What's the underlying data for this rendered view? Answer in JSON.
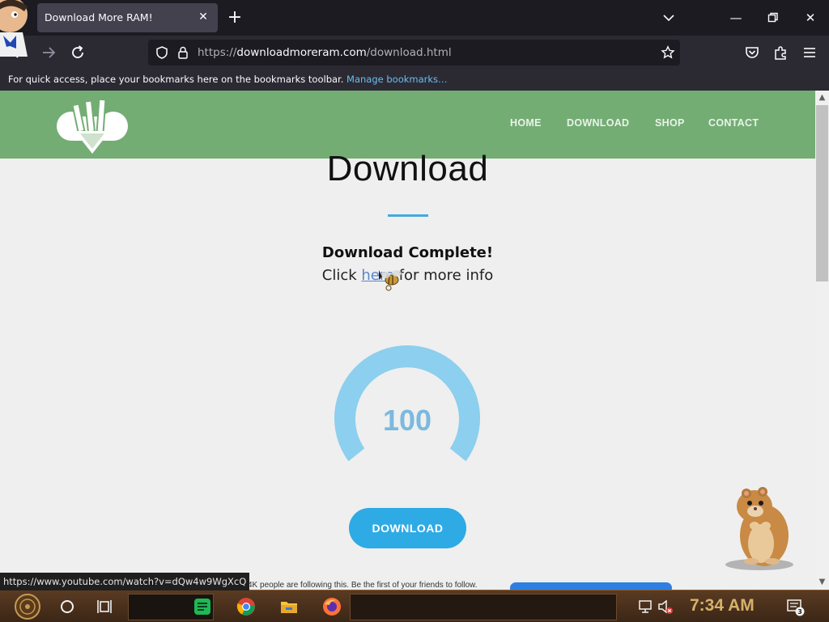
{
  "browser": {
    "tab_title": "Download More RAM!",
    "new_tab_label": "+",
    "url_scheme": "https://",
    "url_domain": "downloadmoreram.com",
    "url_path": "/download.html",
    "bookmarks_hint": "For quick access, place your bookmarks here on the bookmarks toolbar.",
    "bookmarks_link": "Manage bookmarks…",
    "status_url": "https://www.youtube.com/watch?v=dQw4w9WgXcQ"
  },
  "site": {
    "nav": [
      "HOME",
      "DOWNLOAD",
      "SHOP",
      "CONTACT"
    ],
    "heading": "Download",
    "complete_text": "Download Complete!",
    "info_prefix": "Click ",
    "info_link": "here",
    "info_suffix": " for more info",
    "progress_value": "100",
    "download_button": "DOWNLOAD",
    "follow_text": "4K people are following this. Be the first of your friends to follow."
  },
  "taskbar": {
    "clock": "7:34 AM",
    "notification_count": "3"
  },
  "colors": {
    "header_green": "#73ad74",
    "accent_blue": "#2eaae5",
    "gauge_blue": "#8ccfee",
    "gauge_text": "#7cb9de"
  }
}
